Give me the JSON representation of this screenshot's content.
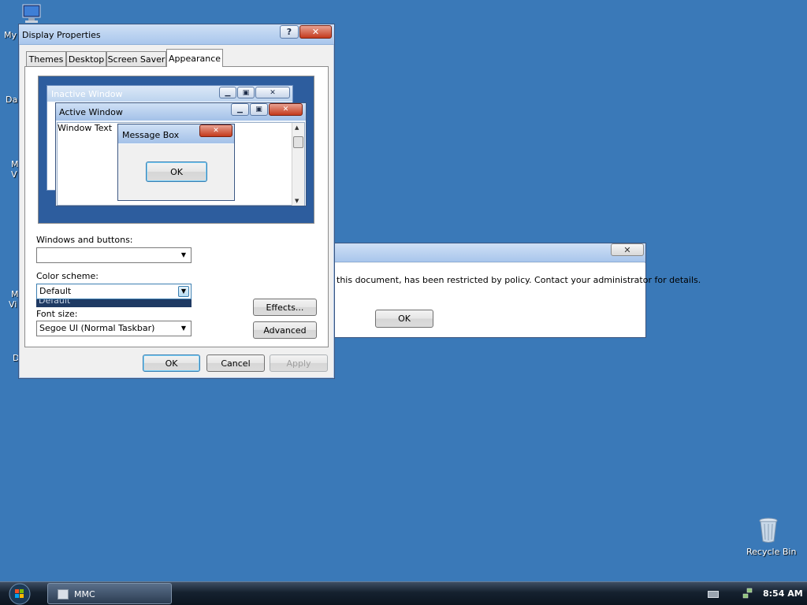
{
  "desktop": {
    "icons": [
      {
        "label": "My",
        "icon": "my-computer-icon"
      },
      {
        "label": "Da"
      },
      {
        "label": "M"
      },
      {
        "label": "V"
      },
      {
        "label": "M"
      },
      {
        "label": "Vi"
      },
      {
        "label": "D"
      }
    ],
    "recycle_bin": {
      "label": "Recycle Bin",
      "icon": "recycle-bin-icon"
    }
  },
  "display_properties": {
    "title": "Display Properties",
    "help_label": "?",
    "close_label": "✕",
    "tabs": [
      "Themes",
      "Desktop",
      "Screen Saver",
      "Appearance"
    ],
    "active_tab": "Appearance",
    "preview": {
      "inactive_title": "Inactive Window",
      "active_title": "Active Window",
      "window_text": "Window Text",
      "message_title": "Message Box",
      "message_ok": "OK"
    },
    "windows_buttons_label": "Windows and buttons:",
    "windows_buttons_value": "",
    "color_scheme_label": "Color scheme:",
    "color_scheme_value": "Default",
    "color_scheme_dropdown_item": "Default",
    "font_size_label": "Font size:",
    "font_size_value": "Segoe UI (Normal Taskbar)",
    "effects_label": "Effects...",
    "advanced_label": "Advanced",
    "ok_label": "OK",
    "cancel_label": "Cancel",
    "apply_label": "Apply"
  },
  "restriction_dialog": {
    "close_label": "✕",
    "message": "this document, has been restricted by policy. Contact your administrator for details.",
    "ok_label": "OK"
  },
  "taskbar": {
    "start_icon": "windows-orb-icon",
    "task_label": "MMC",
    "clock": "8:54 AM",
    "colors": {
      "desktop": "#3a79b8",
      "taskbar": "#15212f"
    }
  }
}
